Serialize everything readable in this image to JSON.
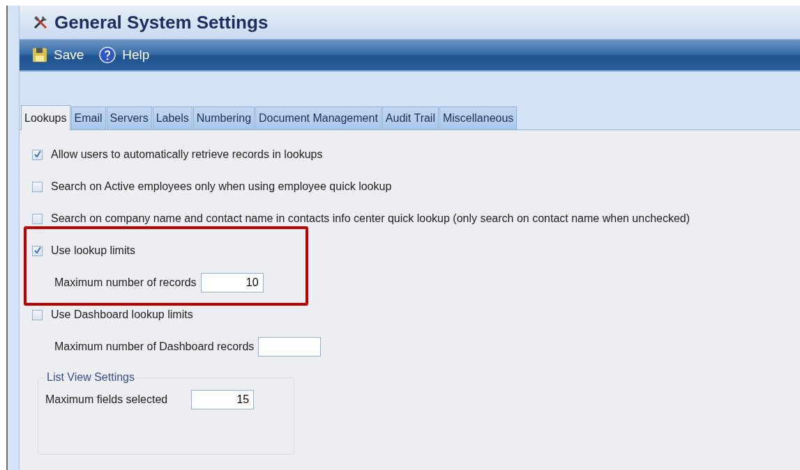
{
  "window": {
    "title": "General System Settings"
  },
  "toolbar": [
    {
      "kind": "save",
      "label": "Save"
    },
    {
      "kind": "help",
      "label": "Help"
    }
  ],
  "tabs": [
    {
      "label": "Lookups",
      "selected": true
    },
    {
      "label": "Email",
      "selected": false
    },
    {
      "label": "Servers",
      "selected": false
    },
    {
      "label": "Labels",
      "selected": false
    },
    {
      "label": "Numbering",
      "selected": false
    },
    {
      "label": "Document Management",
      "selected": false
    },
    {
      "label": "Audit Trail",
      "selected": false
    },
    {
      "label": "Miscellaneous",
      "selected": false
    }
  ],
  "options": [
    {
      "kind": "checkbox",
      "label": "Allow users to automatically retrieve records in lookups",
      "checked": true,
      "highlighted": false
    },
    {
      "kind": "checkbox",
      "label": "Search on Active employees only when using employee quick lookup",
      "checked": false,
      "highlighted": false
    },
    {
      "kind": "checkbox",
      "label": "Search on company name and contact name in contacts info center quick lookup (only search on contact name when unchecked)",
      "checked": false,
      "highlighted": false
    },
    {
      "kind": "checkbox",
      "label": "Use lookup limits",
      "checked": true,
      "highlighted": true
    },
    {
      "kind": "number",
      "label": "Maximum number of records",
      "value": "10",
      "highlighted": true
    },
    {
      "kind": "checkbox",
      "label": "Use Dashboard lookup limits",
      "checked": false,
      "highlighted": false
    },
    {
      "kind": "number",
      "label": "Maximum number of Dashboard records",
      "highlighted": false
    }
  ],
  "list_view_settings": {
    "title": "List View Settings",
    "fields": [
      {
        "label": "Maximum fields selected",
        "value": "15"
      }
    ]
  }
}
